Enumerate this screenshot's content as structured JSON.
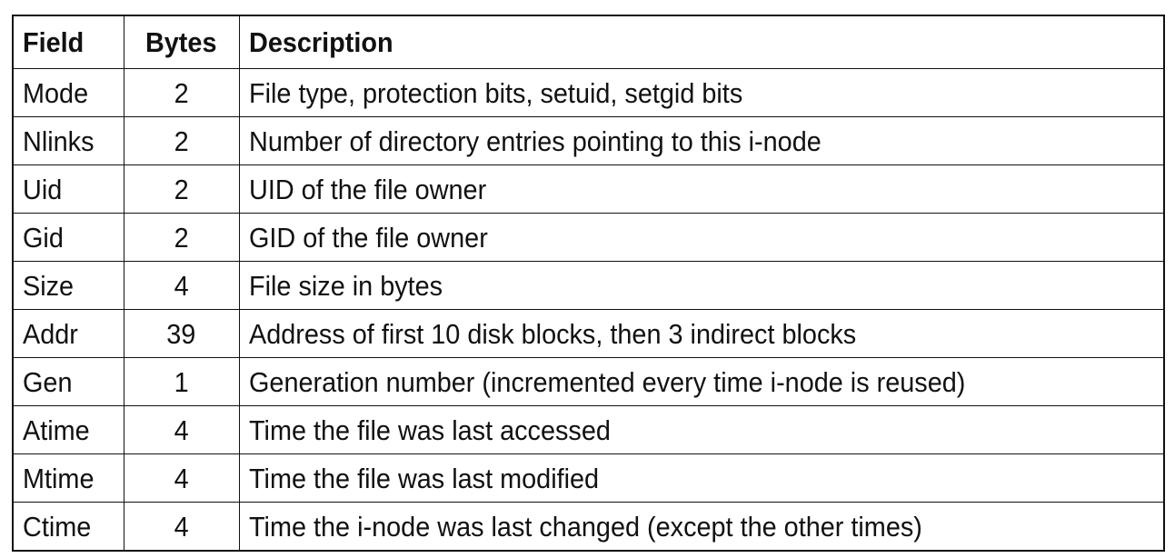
{
  "table": {
    "headers": {
      "field": "Field",
      "bytes": "Bytes",
      "description": "Description"
    },
    "rows": [
      {
        "field": "Mode",
        "bytes": "2",
        "description": "File type, protection bits, setuid, setgid bits"
      },
      {
        "field": "Nlinks",
        "bytes": "2",
        "description": "Number of directory entries pointing to this i-node"
      },
      {
        "field": "Uid",
        "bytes": "2",
        "description": "UID of the file owner"
      },
      {
        "field": "Gid",
        "bytes": "2",
        "description": "GID of the file owner"
      },
      {
        "field": "Size",
        "bytes": "4",
        "description": "File size in bytes"
      },
      {
        "field": "Addr",
        "bytes": "39",
        "description": "Address of first 10 disk blocks, then 3 indirect blocks"
      },
      {
        "field": "Gen",
        "bytes": "1",
        "description": "Generation number (incremented every time i-node is reused)"
      },
      {
        "field": "Atime",
        "bytes": "4",
        "description": "Time the file was last accessed"
      },
      {
        "field": "Mtime",
        "bytes": "4",
        "description": "Time the file was last modified"
      },
      {
        "field": "Ctime",
        "bytes": "4",
        "description": "Time the i-node was last changed (except the other times)"
      }
    ]
  },
  "colors": {
    "border": "#111111",
    "text": "#111111",
    "background": "#ffffff"
  }
}
